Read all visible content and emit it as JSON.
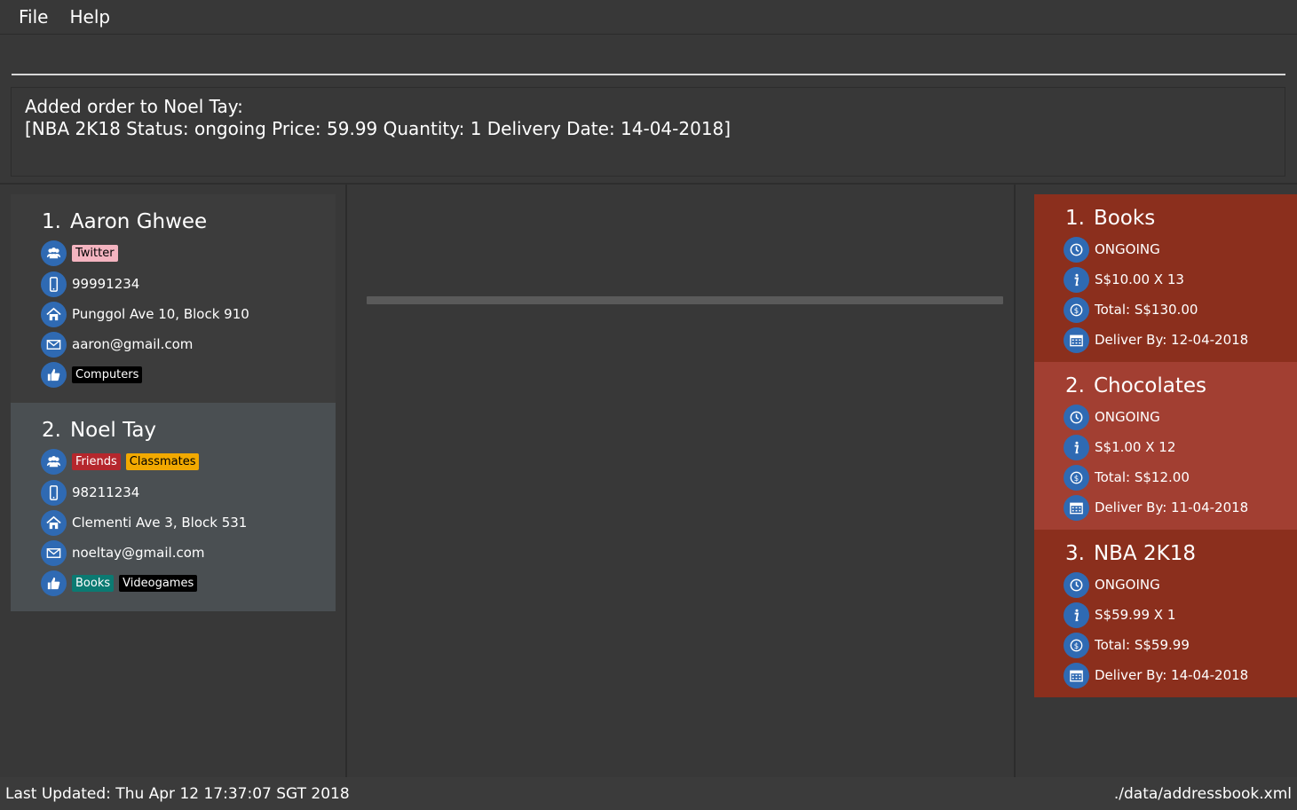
{
  "menu": {
    "file": "File",
    "help": "Help"
  },
  "command": {
    "value": ""
  },
  "result": {
    "line1": "Added order to Noel Tay:",
    "line2": "[NBA 2K18 Status: ongoing Price: 59.99 Quantity: 1 Delivery Date: 14-04-2018]"
  },
  "persons": [
    {
      "index": "1.",
      "name": "Aaron Ghwee",
      "groups": [
        {
          "label": "Twitter",
          "color": "#f4b4c0",
          "text_color": "#000000"
        }
      ],
      "phone": "99991234",
      "address": "Punggol Ave 10, Block 910",
      "email": "aaron@gmail.com",
      "preferences": [
        {
          "label": "Computers",
          "color": "#000000",
          "text_color": "#ffffff"
        }
      ]
    },
    {
      "index": "2.",
      "name": "Noel Tay",
      "groups": [
        {
          "label": "Friends",
          "color": "#b5272d",
          "text_color": "#ffffff"
        },
        {
          "label": "Classmates",
          "color": "#f2a900",
          "text_color": "#000000"
        }
      ],
      "phone": "98211234",
      "address": "Clementi Ave 3, Block 531",
      "email": "noeltay@gmail.com",
      "preferences": [
        {
          "label": "Books",
          "color": "#0b7a72",
          "text_color": "#ffffff"
        },
        {
          "label": "Videogames",
          "color": "#000000",
          "text_color": "#ffffff"
        }
      ]
    }
  ],
  "orders": [
    {
      "index": "1.",
      "name": "Books",
      "status": "ONGOING",
      "price_qty": "S$10.00 X 13",
      "total": "Total: S$130.00",
      "deliver": "Deliver By: 12-04-2018"
    },
    {
      "index": "2.",
      "name": "Chocolates",
      "status": "ONGOING",
      "price_qty": "S$1.00 X 12",
      "total": "Total: S$12.00",
      "deliver": "Deliver By: 11-04-2018"
    },
    {
      "index": "3.",
      "name": "NBA 2K18",
      "status": "ONGOING",
      "price_qty": "S$59.99 X 1",
      "total": "Total: S$59.99",
      "deliver": "Deliver By: 14-04-2018"
    }
  ],
  "status": {
    "last_updated": "Last Updated: Thu Apr 12 17:37:07 SGT 2018",
    "file_path": "./data/addressbook.xml"
  },
  "colors": {
    "background": "#383838",
    "icon_blue": "#2f6ab3",
    "order_card": "#8b2f1d",
    "order_card_alt": "#a23f32",
    "selected_person": "#4a4f52"
  }
}
